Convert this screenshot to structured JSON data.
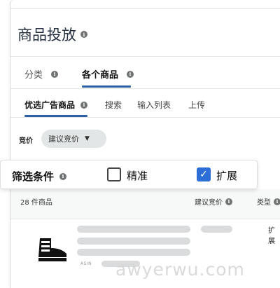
{
  "page": {
    "title": "商品投放"
  },
  "tabs": [
    {
      "label": "分类"
    },
    {
      "label": "各个商品"
    }
  ],
  "subtabs": [
    {
      "label": "优选广告商品"
    },
    {
      "label": "搜索"
    },
    {
      "label": "输入列表"
    },
    {
      "label": "上传"
    }
  ],
  "bid": {
    "label": "竞价",
    "selected": "建议竞价"
  },
  "filter": {
    "title": "筛选条件",
    "exact_label": "精准",
    "expand_label": "扩展",
    "exact_checked": false,
    "expand_checked": true
  },
  "table": {
    "count_label": "28 件商品",
    "col_bid": "建议竞价",
    "col_type": "类型"
  },
  "row": {
    "asin_label": "ASIN",
    "type": "扩展"
  },
  "watermark": "awyerwu.com",
  "colors": {
    "accent": "#2d6ed6",
    "tab_underline": "#2d5fa6",
    "skeleton": "#d9dbdc"
  }
}
